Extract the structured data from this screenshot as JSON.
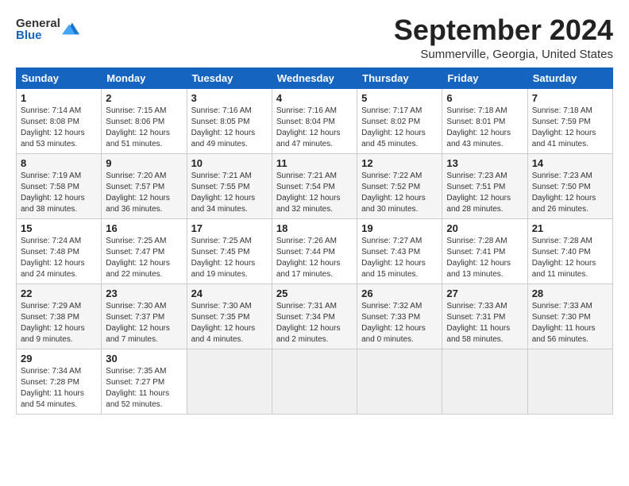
{
  "logo": {
    "general": "General",
    "blue": "Blue"
  },
  "title": "September 2024",
  "subtitle": "Summerville, Georgia, United States",
  "headers": [
    "Sunday",
    "Monday",
    "Tuesday",
    "Wednesday",
    "Thursday",
    "Friday",
    "Saturday"
  ],
  "weeks": [
    [
      {
        "day": "1",
        "info": "Sunrise: 7:14 AM\nSunset: 8:08 PM\nDaylight: 12 hours\nand 53 minutes."
      },
      {
        "day": "2",
        "info": "Sunrise: 7:15 AM\nSunset: 8:06 PM\nDaylight: 12 hours\nand 51 minutes."
      },
      {
        "day": "3",
        "info": "Sunrise: 7:16 AM\nSunset: 8:05 PM\nDaylight: 12 hours\nand 49 minutes."
      },
      {
        "day": "4",
        "info": "Sunrise: 7:16 AM\nSunset: 8:04 PM\nDaylight: 12 hours\nand 47 minutes."
      },
      {
        "day": "5",
        "info": "Sunrise: 7:17 AM\nSunset: 8:02 PM\nDaylight: 12 hours\nand 45 minutes."
      },
      {
        "day": "6",
        "info": "Sunrise: 7:18 AM\nSunset: 8:01 PM\nDaylight: 12 hours\nand 43 minutes."
      },
      {
        "day": "7",
        "info": "Sunrise: 7:18 AM\nSunset: 7:59 PM\nDaylight: 12 hours\nand 41 minutes."
      }
    ],
    [
      {
        "day": "8",
        "info": "Sunrise: 7:19 AM\nSunset: 7:58 PM\nDaylight: 12 hours\nand 38 minutes."
      },
      {
        "day": "9",
        "info": "Sunrise: 7:20 AM\nSunset: 7:57 PM\nDaylight: 12 hours\nand 36 minutes."
      },
      {
        "day": "10",
        "info": "Sunrise: 7:21 AM\nSunset: 7:55 PM\nDaylight: 12 hours\nand 34 minutes."
      },
      {
        "day": "11",
        "info": "Sunrise: 7:21 AM\nSunset: 7:54 PM\nDaylight: 12 hours\nand 32 minutes."
      },
      {
        "day": "12",
        "info": "Sunrise: 7:22 AM\nSunset: 7:52 PM\nDaylight: 12 hours\nand 30 minutes."
      },
      {
        "day": "13",
        "info": "Sunrise: 7:23 AM\nSunset: 7:51 PM\nDaylight: 12 hours\nand 28 minutes."
      },
      {
        "day": "14",
        "info": "Sunrise: 7:23 AM\nSunset: 7:50 PM\nDaylight: 12 hours\nand 26 minutes."
      }
    ],
    [
      {
        "day": "15",
        "info": "Sunrise: 7:24 AM\nSunset: 7:48 PM\nDaylight: 12 hours\nand 24 minutes."
      },
      {
        "day": "16",
        "info": "Sunrise: 7:25 AM\nSunset: 7:47 PM\nDaylight: 12 hours\nand 22 minutes."
      },
      {
        "day": "17",
        "info": "Sunrise: 7:25 AM\nSunset: 7:45 PM\nDaylight: 12 hours\nand 19 minutes."
      },
      {
        "day": "18",
        "info": "Sunrise: 7:26 AM\nSunset: 7:44 PM\nDaylight: 12 hours\nand 17 minutes."
      },
      {
        "day": "19",
        "info": "Sunrise: 7:27 AM\nSunset: 7:43 PM\nDaylight: 12 hours\nand 15 minutes."
      },
      {
        "day": "20",
        "info": "Sunrise: 7:28 AM\nSunset: 7:41 PM\nDaylight: 12 hours\nand 13 minutes."
      },
      {
        "day": "21",
        "info": "Sunrise: 7:28 AM\nSunset: 7:40 PM\nDaylight: 12 hours\nand 11 minutes."
      }
    ],
    [
      {
        "day": "22",
        "info": "Sunrise: 7:29 AM\nSunset: 7:38 PM\nDaylight: 12 hours\nand 9 minutes."
      },
      {
        "day": "23",
        "info": "Sunrise: 7:30 AM\nSunset: 7:37 PM\nDaylight: 12 hours\nand 7 minutes."
      },
      {
        "day": "24",
        "info": "Sunrise: 7:30 AM\nSunset: 7:35 PM\nDaylight: 12 hours\nand 4 minutes."
      },
      {
        "day": "25",
        "info": "Sunrise: 7:31 AM\nSunset: 7:34 PM\nDaylight: 12 hours\nand 2 minutes."
      },
      {
        "day": "26",
        "info": "Sunrise: 7:32 AM\nSunset: 7:33 PM\nDaylight: 12 hours\nand 0 minutes."
      },
      {
        "day": "27",
        "info": "Sunrise: 7:33 AM\nSunset: 7:31 PM\nDaylight: 11 hours\nand 58 minutes."
      },
      {
        "day": "28",
        "info": "Sunrise: 7:33 AM\nSunset: 7:30 PM\nDaylight: 11 hours\nand 56 minutes."
      }
    ],
    [
      {
        "day": "29",
        "info": "Sunrise: 7:34 AM\nSunset: 7:28 PM\nDaylight: 11 hours\nand 54 minutes."
      },
      {
        "day": "30",
        "info": "Sunrise: 7:35 AM\nSunset: 7:27 PM\nDaylight: 11 hours\nand 52 minutes."
      },
      {
        "day": "",
        "info": ""
      },
      {
        "day": "",
        "info": ""
      },
      {
        "day": "",
        "info": ""
      },
      {
        "day": "",
        "info": ""
      },
      {
        "day": "",
        "info": ""
      }
    ]
  ]
}
